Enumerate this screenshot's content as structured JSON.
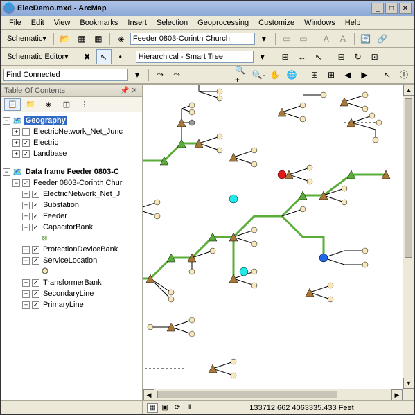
{
  "window": {
    "title": "ElecDemo.mxd - ArcMap"
  },
  "menu": [
    "File",
    "Edit",
    "View",
    "Bookmarks",
    "Insert",
    "Selection",
    "Geoprocessing",
    "Customize",
    "Windows",
    "Help"
  ],
  "tb1": {
    "schematic": "Schematic",
    "feeder": "Feeder 0803-Corinth Church"
  },
  "tb2": {
    "editor": "Schematic Editor",
    "layout": "Hierarchical - Smart Tree"
  },
  "tb3": {
    "find": "Find Connected"
  },
  "toc": {
    "title": "Table Of Contents",
    "geography": "Geography",
    "layers1": [
      "ElectricNetwork_Net_Junc",
      "Electric",
      "Landbase"
    ],
    "dataframe": "Data frame Feeder 0803-C",
    "feeder": "Feeder 0803-Corinth Chur",
    "layers2": [
      "ElectricNetwork_Net_J",
      "Substation",
      "Feeder",
      "CapacitorBank",
      "ProtectionDeviceBank",
      "ServiceLocation",
      "TransformerBank",
      "SecondaryLine",
      "PrimaryLine"
    ]
  },
  "status": {
    "coords": "133712.662 4063335.433 Feet"
  }
}
